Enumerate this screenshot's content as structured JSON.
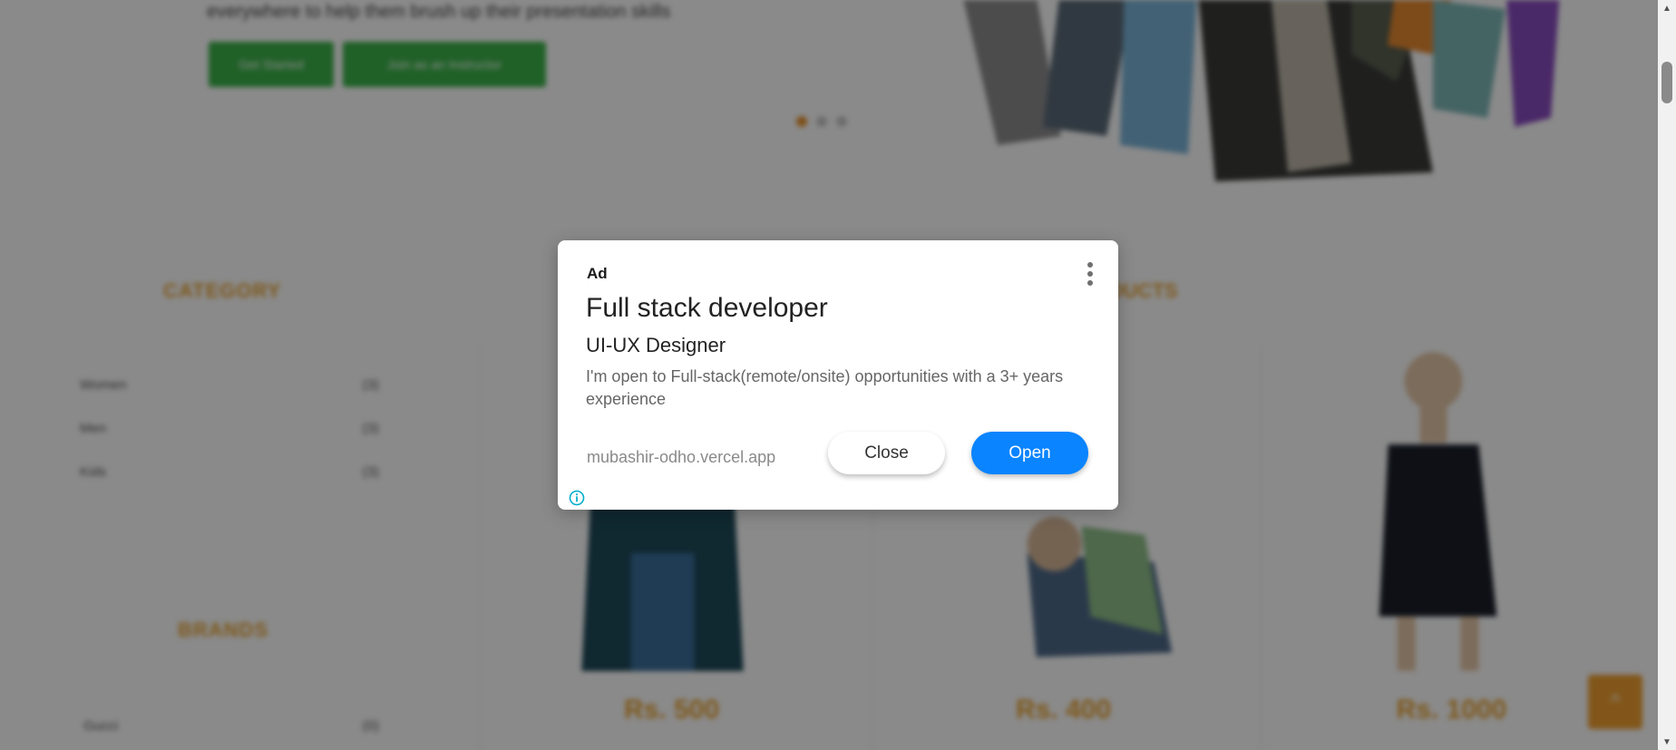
{
  "background": {
    "hero": {
      "tagline": "everywhere to help them brush up their presentation skills",
      "buttons": [
        "Get Started",
        "Join as an Instructor"
      ],
      "dots": 3,
      "active_dot": 0
    },
    "category_heading": "CATEGORY",
    "categories": [
      {
        "name": "Women",
        "count": "(3)"
      },
      {
        "name": "Men",
        "count": "(3)"
      },
      {
        "name": "Kids",
        "count": "(3)"
      }
    ],
    "brands_heading": "BRANDS",
    "brands": [
      {
        "name": "Gucci",
        "count": "(0)"
      }
    ],
    "products_heading": "PRODUCTS",
    "products": [
      {
        "price": "Rs. 500"
      },
      {
        "price": "Rs. 400"
      },
      {
        "price": "Rs. 1000"
      }
    ],
    "back_to_top_icon": "chevron-up-icon",
    "accent_color": "#e8a230",
    "hero_button_color": "#3cb34a"
  },
  "ad": {
    "label": "Ad",
    "title": "Full stack developer",
    "subtitle": "UI-UX Designer",
    "body": "I'm open to Full-stack(remote/onsite) opportunities with a 3+ years experience",
    "url": "mubashir-odho.vercel.app",
    "close_label": "Close",
    "open_label": "Open",
    "open_color": "#0a84ff",
    "info_icon": "info-icon",
    "menu_icon": "more-vertical-icon"
  },
  "scrollbar": {
    "up_icon": "scroll-up-arrow",
    "down_icon": "scroll-down-arrow"
  }
}
